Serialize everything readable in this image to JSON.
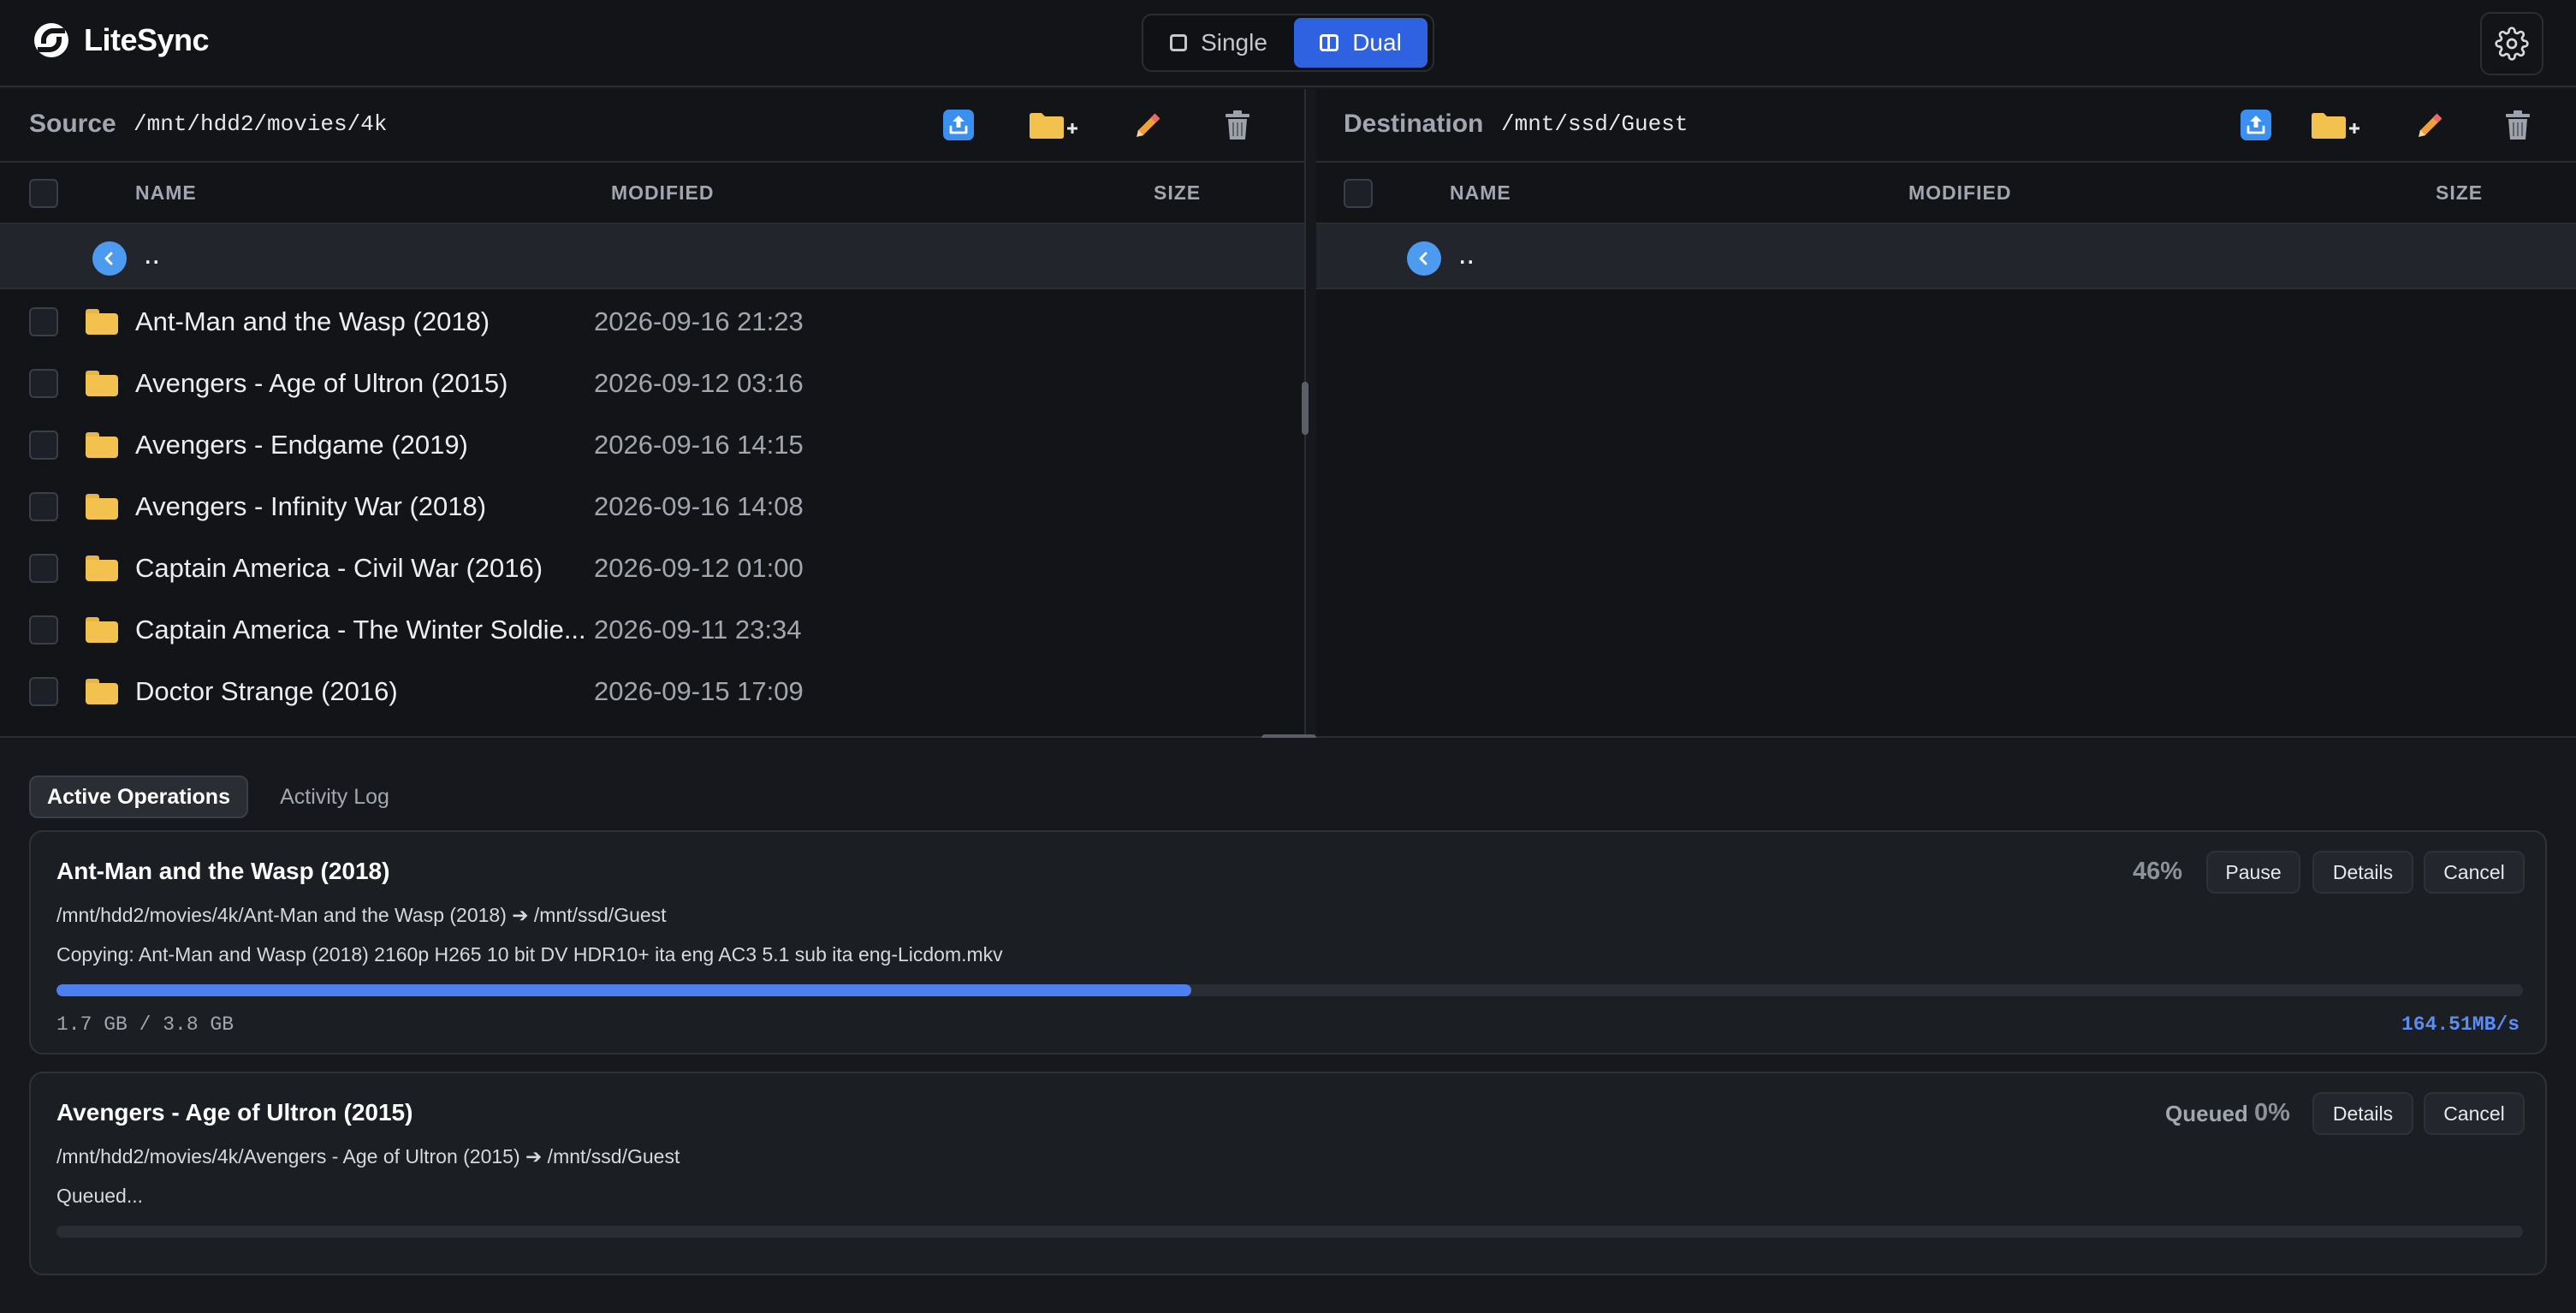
{
  "app": {
    "name": "LiteSync"
  },
  "mode_toggle": {
    "single_label": "Single",
    "dual_label": "Dual",
    "active": "Dual"
  },
  "icons": {
    "logo": "litesync-logo-icon",
    "settings": "gear-icon",
    "upload": "upload-icon",
    "new_folder": "new-folder-icon",
    "rename": "pencil-icon",
    "delete": "trash-icon",
    "parent": "chevron-left-icon",
    "folder": "folder-icon"
  },
  "colors": {
    "accent": "#2f62e0",
    "progress": "#4c7ff0",
    "folder": "#f2c14e",
    "speed": "#5b8df5"
  },
  "source": {
    "label": "Source",
    "path": "/mnt/hdd2/movies/4k",
    "columns": {
      "name": "NAME",
      "modified": "MODIFIED",
      "size": "SIZE"
    },
    "parent_label": "..",
    "files": [
      {
        "name": "Ant-Man and the Wasp (2018)",
        "modified": "2026-09-16 21:23"
      },
      {
        "name": "Avengers - Age of Ultron (2015)",
        "modified": "2026-09-12 03:16"
      },
      {
        "name": "Avengers - Endgame (2019)",
        "modified": "2026-09-16 14:15"
      },
      {
        "name": "Avengers - Infinity War (2018)",
        "modified": "2026-09-16 14:08"
      },
      {
        "name": "Captain America - Civil War (2016)",
        "modified": "2026-09-12 01:00"
      },
      {
        "name": "Captain America - The Winter Soldie...",
        "modified": "2026-09-11 23:34"
      },
      {
        "name": "Doctor Strange (2016)",
        "modified": "2026-09-15 17:09"
      }
    ]
  },
  "destination": {
    "label": "Destination",
    "path": "/mnt/ssd/Guest",
    "columns": {
      "name": "NAME",
      "modified": "MODIFIED",
      "size": "SIZE"
    },
    "parent_label": ".."
  },
  "tabs": {
    "active_operations": "Active Operations",
    "activity_log": "Activity Log"
  },
  "operations": [
    {
      "title": "Ant-Man and the Wasp (2018)",
      "path": "/mnt/hdd2/movies/4k/Ant-Man and the Wasp (2018) ➔ /mnt/ssd/Guest",
      "status": "Copying: Ant-Man and Wasp (2018) 2160p H265 10 bit DV HDR10+ ita eng AC3 5.1 sub ita eng-Licdom.mkv",
      "percent": "46%",
      "progress": 0.46,
      "size": "1.7 GB / 3.8 GB",
      "speed": "164.51MB/s",
      "pause_label": "Pause",
      "details_label": "Details",
      "cancel_label": "Cancel"
    },
    {
      "title": "Avengers - Age of Ultron (2015)",
      "path": "/mnt/hdd2/movies/4k/Avengers - Age of Ultron (2015) ➔ /mnt/ssd/Guest",
      "status": "Queued...",
      "queued_label": "Queued",
      "percent": "0%",
      "progress": 0,
      "details_label": "Details",
      "cancel_label": "Cancel"
    }
  ]
}
